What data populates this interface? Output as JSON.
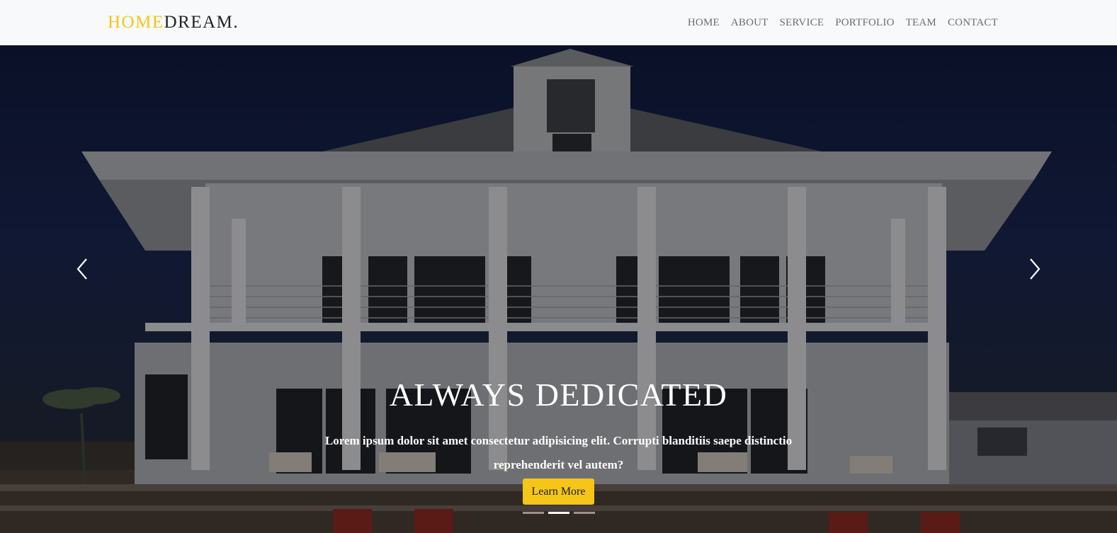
{
  "brand": {
    "part1": "HOME",
    "part2": "DREAM."
  },
  "nav": [
    "HOME",
    "ABOUT",
    "SERVICE",
    "PORTFOLIO",
    "TEAM",
    "CONTACT"
  ],
  "hero": {
    "title": "ALWAYS DEDICATED",
    "text": "Lorem ipsum dolor sit amet consectetur adipisicing elit. Corrupti blanditiis saepe distinctio reprehenderit vel autem?",
    "button": "Learn More",
    "prev_icon": "chevron-left-icon",
    "next_icon": "chevron-right-icon",
    "slides": 3,
    "active_slide": 2
  },
  "colors": {
    "accent": "#f5c518",
    "brand_dark": "#222222",
    "nav_text": "#6c6c6c",
    "navbar_bg": "#f8f9fa"
  }
}
